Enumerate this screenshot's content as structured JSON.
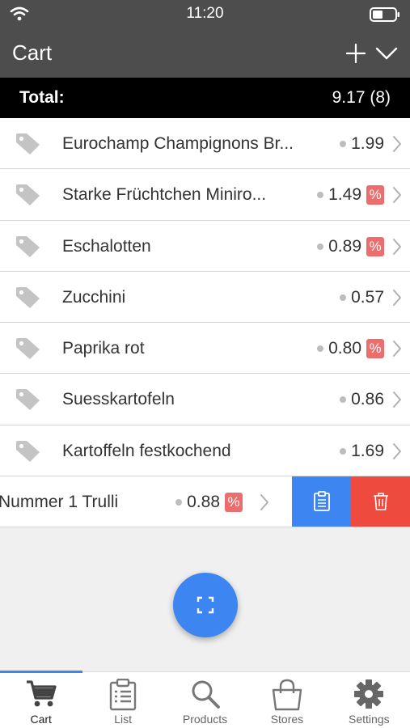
{
  "status_bar": {
    "time": "11:20",
    "icons": [
      "wifi-icon",
      "battery-icon"
    ]
  },
  "header": {
    "title": "Cart",
    "add_icon": "plus-icon",
    "collapse_icon": "chevron-down-icon"
  },
  "total": {
    "label": "Total:",
    "value": "9.17 (8)"
  },
  "items": [
    {
      "name": "Eurochamp Champignons Br...",
      "price": "1.99",
      "discount": false
    },
    {
      "name": "Starke Früchtchen Miniro...",
      "price": "1.49",
      "discount": true
    },
    {
      "name": "Eschalotten",
      "price": "0.89",
      "discount": true
    },
    {
      "name": "Zucchini",
      "price": "0.57",
      "discount": false
    },
    {
      "name": "Paprika rot",
      "price": "0.80",
      "discount": true
    },
    {
      "name": "Suesskartofeln",
      "price": "0.86",
      "discount": false
    },
    {
      "name": "Kartoffeln festkochend",
      "price": "1.69",
      "discount": false
    }
  ],
  "swiped_item": {
    "name": "Nummer 1 Trulli",
    "price": "0.88",
    "discount": true,
    "actions": [
      "clipboard-icon",
      "trash-icon"
    ]
  },
  "discount_badge": "%",
  "fab_icon": "scan-icon",
  "tabs": [
    {
      "label": "Cart",
      "icon": "cart-icon",
      "active": true
    },
    {
      "label": "List",
      "icon": "clipboard-list-icon",
      "active": false
    },
    {
      "label": "Products",
      "icon": "search-icon",
      "active": false
    },
    {
      "label": "Stores",
      "icon": "shopping-bag-icon",
      "active": false
    },
    {
      "label": "Settings",
      "icon": "gear-icon",
      "active": false
    }
  ],
  "colors": {
    "header": "#4d4d4d",
    "accent": "#3d85f0",
    "delete": "#ee4b3e",
    "discount": "#ec6d6d"
  }
}
